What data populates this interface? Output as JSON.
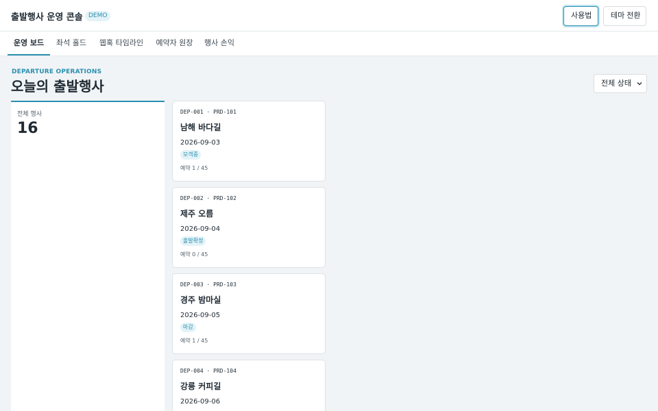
{
  "app": {
    "title": "출발행사 운영 콘솔",
    "badge": "DEMO"
  },
  "toolbar": {
    "help_label": "사용법",
    "theme_label": "테마 전환"
  },
  "tabs": [
    {
      "label": "운영 보드",
      "active": true
    },
    {
      "label": "좌석 홀드",
      "active": false
    },
    {
      "label": "웹훅 타임라인",
      "active": false
    },
    {
      "label": "예약자 원장",
      "active": false
    },
    {
      "label": "행사 손익",
      "active": false
    }
  ],
  "page": {
    "eyebrow": "DEPARTURE OPERATIONS",
    "title": "오늘의 출발행사",
    "filter_value": "전체 상태"
  },
  "stats": {
    "total_label": "전체 행사",
    "total_value": "16"
  },
  "departures": [
    {
      "code": "DEP-001 · PRD-101",
      "name": "남해 바다길",
      "date": "2026-09-03",
      "status": "모객중",
      "booking": "예약 1 / 45"
    },
    {
      "code": "DEP-002 · PRD-102",
      "name": "제주 오름",
      "date": "2026-09-04",
      "status": "출발확정",
      "booking": "예약 0 / 45"
    },
    {
      "code": "DEP-003 · PRD-103",
      "name": "경주 밤마실",
      "date": "2026-09-05",
      "status": "마감",
      "booking": "예약 1 / 45"
    },
    {
      "code": "DEP-004 · PRD-104",
      "name": "강릉 커피길",
      "date": "2026-09-06",
      "status": "",
      "booking": ""
    }
  ],
  "colors": {
    "accent": "#2b8fb0",
    "badge_bg": "#e3f3f8",
    "page_bg": "#f1f4f6"
  }
}
